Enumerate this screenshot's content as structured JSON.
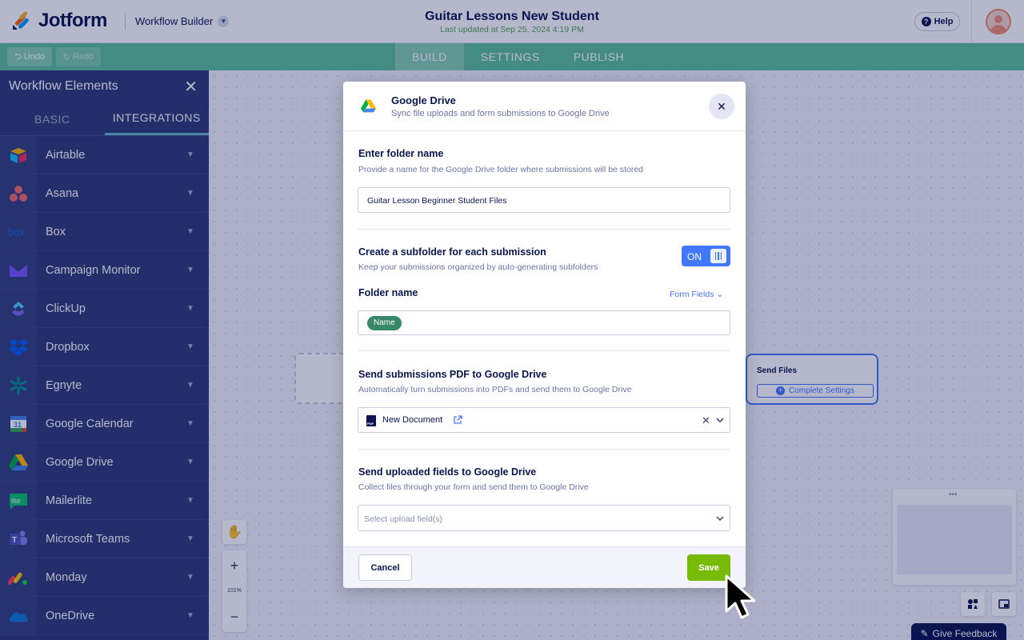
{
  "app": {
    "brand": "Jotform",
    "workflow_builder": "Workflow Builder",
    "title": "Guitar Lessons New Student",
    "last_updated": "Last updated at Sep 25, 2024 4:19 PM",
    "help": "Help"
  },
  "toolbar": {
    "undo": "Undo",
    "redo": "Redo"
  },
  "nav": {
    "tabs": [
      "BUILD",
      "SETTINGS",
      "PUBLISH"
    ],
    "active": "BUILD"
  },
  "sidebar": {
    "title": "Workflow Elements",
    "tabs": [
      "BASIC",
      "INTEGRATIONS"
    ],
    "active_tab": "INTEGRATIONS",
    "items": [
      {
        "label": "Airtable",
        "icon": "airtable-icon"
      },
      {
        "label": "Asana",
        "icon": "asana-icon"
      },
      {
        "label": "Box",
        "icon": "box-icon"
      },
      {
        "label": "Campaign Monitor",
        "icon": "campaign-monitor-icon"
      },
      {
        "label": "ClickUp",
        "icon": "clickup-icon"
      },
      {
        "label": "Dropbox",
        "icon": "dropbox-icon"
      },
      {
        "label": "Egnyte",
        "icon": "egnyte-icon"
      },
      {
        "label": "Google Calendar",
        "icon": "google-calendar-icon"
      },
      {
        "label": "Google Drive",
        "icon": "google-drive-icon"
      },
      {
        "label": "Mailerlite",
        "icon": "mailerlite-icon"
      },
      {
        "label": "Microsoft Teams",
        "icon": "microsoft-teams-icon"
      },
      {
        "label": "Monday",
        "icon": "monday-icon"
      },
      {
        "label": "OneDrive",
        "icon": "onedrive-icon"
      }
    ]
  },
  "canvas": {
    "node_send_title": "Send Files",
    "node_send_button": "Complete Settings",
    "zoom_level": "101%",
    "give_feedback": "Give Feedback"
  },
  "modal": {
    "title": "Google Drive",
    "subtitle": "Sync file uploads and form submissions to Google Drive",
    "folder_section": {
      "title": "Enter folder name",
      "description": "Provide a name for the Google Drive folder where submissions will be stored",
      "value": "Guitar Lesson Beginner Student Files"
    },
    "subfolder_section": {
      "title": "Create a subfolder for each submission",
      "description": "Keep your submissions organized by auto-generating subfolders",
      "toggle": "ON",
      "folder_name_label": "Folder name",
      "form_fields": "Form Fields",
      "chip": "Name"
    },
    "pdf_section": {
      "title": "Send submissions PDF to Google Drive",
      "description": "Automatically turn submissions into PDFs and send them to Google Drive",
      "selected": "New Document",
      "pdf_badge": "PDF"
    },
    "upload_section": {
      "title": "Send uploaded fields to Google Drive",
      "description": "Collect files through your form and send them to Google Drive",
      "placeholder": "Select upload field(s)"
    },
    "cancel": "Cancel",
    "save": "Save"
  },
  "colors": {
    "accent_blue": "#4277ff",
    "save_green": "#78bb07",
    "nav_green": "#5ec09a",
    "sidebar_bg": "#2f3a78",
    "chip_green": "#37876a"
  }
}
